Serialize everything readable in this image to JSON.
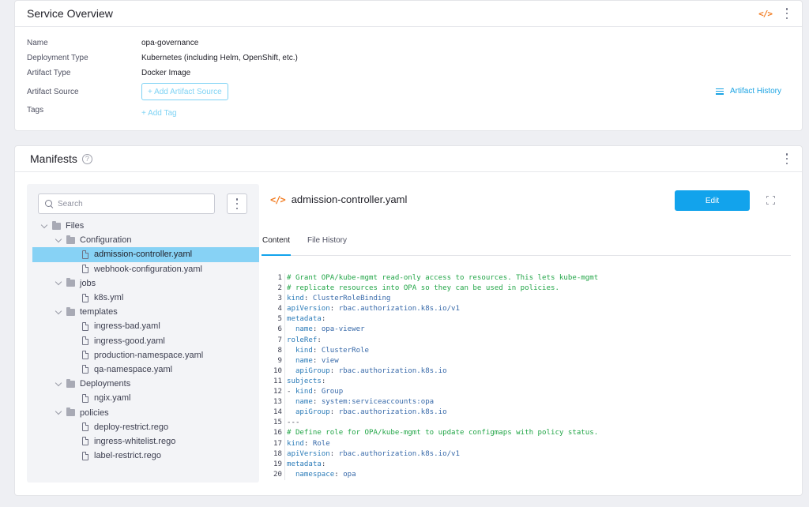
{
  "overview": {
    "title": "Service Overview",
    "code_icon": "code-icon",
    "fields": [
      {
        "label": "Name",
        "value": "opa-governance"
      },
      {
        "label": "Deployment Type",
        "value": "Kubernetes (including Helm, OpenShift, etc.)"
      },
      {
        "label": "Artifact Type",
        "value": "Docker Image"
      },
      {
        "label": "Artifact Source",
        "value": "+ Add Artifact Source"
      },
      {
        "label": "Tags",
        "value": "+ Add Tag"
      }
    ],
    "artifact_history": "Artifact History"
  },
  "manifests": {
    "title": "Manifests",
    "search_placeholder": "Search",
    "tree": [
      {
        "label": "Files",
        "type": "folder",
        "depth": 0
      },
      {
        "label": "Configuration",
        "type": "folder",
        "depth": 1
      },
      {
        "label": "admission-controller.yaml",
        "type": "file",
        "depth": 2,
        "selected": true
      },
      {
        "label": "webhook-configuration.yaml",
        "type": "file",
        "depth": 2
      },
      {
        "label": "jobs",
        "type": "folder",
        "depth": 1
      },
      {
        "label": "k8s.yml",
        "type": "file",
        "depth": 2
      },
      {
        "label": "templates",
        "type": "folder",
        "depth": 1
      },
      {
        "label": "ingress-bad.yaml",
        "type": "file",
        "depth": 2
      },
      {
        "label": "ingress-good.yaml",
        "type": "file",
        "depth": 2
      },
      {
        "label": "production-namespace.yaml",
        "type": "file",
        "depth": 2
      },
      {
        "label": "qa-namespace.yaml",
        "type": "file",
        "depth": 2
      },
      {
        "label": "Deployments",
        "type": "folder",
        "depth": 1
      },
      {
        "label": "ngix.yaml",
        "type": "file",
        "depth": 2
      },
      {
        "label": "policies",
        "type": "folder",
        "depth": 1
      },
      {
        "label": "deploy-restrict.rego",
        "type": "file",
        "depth": 2
      },
      {
        "label": "ingress-whitelist.rego",
        "type": "file",
        "depth": 2
      },
      {
        "label": "label-restrict.rego",
        "type": "file",
        "depth": 2
      }
    ],
    "editor": {
      "file_name": "admission-controller.yaml",
      "edit_label": "Edit",
      "tabs": [
        {
          "label": "Content",
          "active": true
        },
        {
          "label": "File History",
          "active": false
        }
      ],
      "lines": [
        [
          {
            "t": "# Grant OPA/kube-mgmt read-only access to resources. This lets kube-mgmt",
            "c": "comment"
          }
        ],
        [
          {
            "t": "# replicate resources into OPA so they can be used in policies.",
            "c": "comment"
          }
        ],
        [
          {
            "t": "kind",
            "c": "key"
          },
          {
            "t": ": ",
            "c": "punc"
          },
          {
            "t": "ClusterRoleBinding",
            "c": "val"
          }
        ],
        [
          {
            "t": "apiVersion",
            "c": "key"
          },
          {
            "t": ": ",
            "c": "punc"
          },
          {
            "t": "rbac.authorization.k8s.io/v1",
            "c": "val"
          }
        ],
        [
          {
            "t": "metadata",
            "c": "key"
          },
          {
            "t": ":",
            "c": "punc"
          }
        ],
        [
          {
            "t": "  name",
            "c": "key"
          },
          {
            "t": ": ",
            "c": "punc"
          },
          {
            "t": "opa-viewer",
            "c": "val"
          }
        ],
        [
          {
            "t": "roleRef",
            "c": "key"
          },
          {
            "t": ":",
            "c": "punc"
          }
        ],
        [
          {
            "t": "  kind",
            "c": "key"
          },
          {
            "t": ": ",
            "c": "punc"
          },
          {
            "t": "ClusterRole",
            "c": "val"
          }
        ],
        [
          {
            "t": "  name",
            "c": "key"
          },
          {
            "t": ": ",
            "c": "punc"
          },
          {
            "t": "view",
            "c": "val"
          }
        ],
        [
          {
            "t": "  apiGroup",
            "c": "key"
          },
          {
            "t": ": ",
            "c": "punc"
          },
          {
            "t": "rbac.authorization.k8s.io",
            "c": "val"
          }
        ],
        [
          {
            "t": "subjects",
            "c": "key"
          },
          {
            "t": ":",
            "c": "punc"
          }
        ],
        [
          {
            "t": "- ",
            "c": "punc"
          },
          {
            "t": "kind",
            "c": "key"
          },
          {
            "t": ": ",
            "c": "punc"
          },
          {
            "t": "Group",
            "c": "val"
          }
        ],
        [
          {
            "t": "  name",
            "c": "key"
          },
          {
            "t": ": ",
            "c": "punc"
          },
          {
            "t": "system:serviceaccounts:opa",
            "c": "val"
          }
        ],
        [
          {
            "t": "  apiGroup",
            "c": "key"
          },
          {
            "t": ": ",
            "c": "punc"
          },
          {
            "t": "rbac.authorization.k8s.io",
            "c": "val"
          }
        ],
        [
          {
            "t": "---",
            "c": "punc"
          }
        ],
        [
          {
            "t": "# Define role for OPA/kube-mgmt to update configmaps with policy status.",
            "c": "comment"
          }
        ],
        [
          {
            "t": "kind",
            "c": "key"
          },
          {
            "t": ": ",
            "c": "punc"
          },
          {
            "t": "Role",
            "c": "val"
          }
        ],
        [
          {
            "t": "apiVersion",
            "c": "key"
          },
          {
            "t": ": ",
            "c": "punc"
          },
          {
            "t": "rbac.authorization.k8s.io/v1",
            "c": "val"
          }
        ],
        [
          {
            "t": "metadata",
            "c": "key"
          },
          {
            "t": ":",
            "c": "punc"
          }
        ],
        [
          {
            "t": "  namespace",
            "c": "key"
          },
          {
            "t": ": ",
            "c": "punc"
          },
          {
            "t": "opa",
            "c": "val"
          }
        ]
      ]
    }
  },
  "colors": {
    "accent": "#12a3ec",
    "selected_row": "#87d2f5",
    "code_icon": "#f27b20",
    "comment": "#22a547",
    "key": "#2a7bb8"
  }
}
